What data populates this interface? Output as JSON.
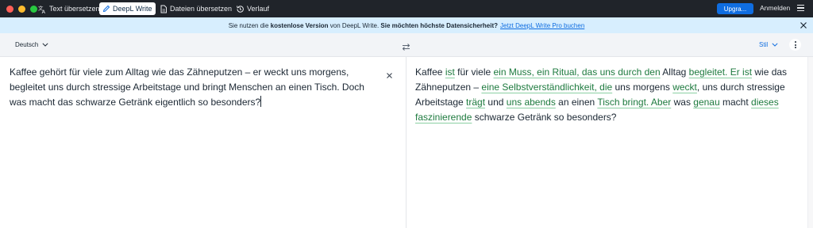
{
  "toolbar": {
    "tabs": [
      {
        "label": "Text übersetzen",
        "icon": "translate-icon",
        "active": false
      },
      {
        "label": "DeepL Write",
        "icon": "pen-icon",
        "active": true
      },
      {
        "label": "Dateien übersetzen",
        "icon": "file-icon",
        "active": false
      },
      {
        "label": "Verlauf",
        "icon": "history-icon",
        "active": false
      }
    ],
    "upgrade_label": "Upgra...",
    "login_label": "Anmelden",
    "colors": {
      "bar": "#20242a",
      "accent": "#0f6de0"
    }
  },
  "banner": {
    "prefix": "Sie nutzen die",
    "bold1": "kostenlose Version",
    "middle": "von DeepL Write.",
    "bold2": "Sie möchten höchste Datensicherheit?",
    "link": "Jetzt DeepL Write Pro buchen",
    "background": "#d7eefe"
  },
  "options": {
    "language": "Deutsch",
    "style": "Stil"
  },
  "editor": {
    "source_text": "Kaffee gehört für viele zum Alltag wie das Zähneputzen – er weckt uns morgens, begleitet uns durch stressige Arbeitstage und bringt Menschen an einen Tisch. Doch was macht das schwarze Getränk eigentlich so besonders?",
    "result_segments": [
      {
        "text": "Kaffee ",
        "changed": false
      },
      {
        "text": "ist",
        "changed": true
      },
      {
        "text": " für viele ",
        "changed": false
      },
      {
        "text": "ein Muss, ein Ritual, das uns durch den",
        "changed": true
      },
      {
        "text": " Alltag ",
        "changed": false
      },
      {
        "text": "begleitet. Er ist",
        "changed": true
      },
      {
        "text": " wie das Zähneputzen – ",
        "changed": false
      },
      {
        "text": "eine Selbstverständlichkeit, die",
        "changed": true
      },
      {
        "text": " uns morgens ",
        "changed": false
      },
      {
        "text": "weckt",
        "changed": true
      },
      {
        "text": ", uns durch stressige Arbeitstage ",
        "changed": false
      },
      {
        "text": "trägt",
        "changed": true
      },
      {
        "text": " und ",
        "changed": false
      },
      {
        "text": "uns abends",
        "changed": true
      },
      {
        "text": " an einen ",
        "changed": false
      },
      {
        "text": "Tisch bringt. Aber",
        "changed": true
      },
      {
        "text": " was ",
        "changed": false
      },
      {
        "text": "genau",
        "changed": true
      },
      {
        "text": " macht ",
        "changed": false
      },
      {
        "text": "dieses faszinierende",
        "changed": true
      },
      {
        "text": " schwarze Getränk so besonders?",
        "changed": false
      }
    ],
    "change_color": "#1d7a3e"
  }
}
